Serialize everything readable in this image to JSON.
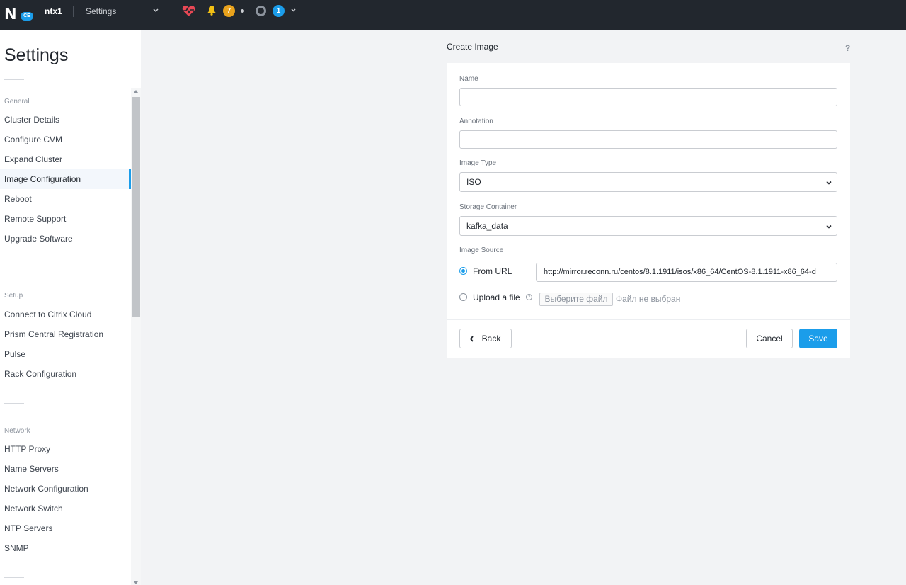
{
  "topbar": {
    "logo_mark": "N",
    "logo_badge": "CE",
    "cluster_name": "ntx1",
    "nav_label": "Settings",
    "alert_count": "7",
    "task_count": "1",
    "icons": [
      "nutanix-logo",
      "chevron-down-icon",
      "heart-health-icon",
      "bell-icon",
      "status-dot-icon",
      "tasks-ring-icon",
      "chevron-down-icon"
    ],
    "colors": {
      "bar": "#22272e",
      "heart": "#e84855",
      "bell": "#f2c014",
      "alert_badge": "#e8a21c",
      "task_badge": "#1b9dea"
    }
  },
  "sidebar": {
    "title": "Settings",
    "sections": [
      {
        "heading": "General",
        "items": [
          "Cluster Details",
          "Configure CVM",
          "Expand Cluster",
          "Image Configuration",
          "Reboot",
          "Remote Support",
          "Upgrade Software"
        ]
      },
      {
        "heading": "Setup",
        "items": [
          "Connect to Citrix Cloud",
          "Prism Central Registration",
          "Pulse",
          "Rack Configuration"
        ]
      },
      {
        "heading": "Network",
        "items": [
          "HTTP Proxy",
          "Name Servers",
          "Network Configuration",
          "Network Switch",
          "NTP Servers",
          "SNMP"
        ]
      }
    ],
    "active_item": "Image Configuration"
  },
  "dialog": {
    "title": "Create Image",
    "help": "?",
    "name_label": "Name",
    "name_value": "",
    "annotation_label": "Annotation",
    "annotation_value": "",
    "image_type_label": "Image Type",
    "image_type_value": "ISO",
    "storage_label": "Storage Container",
    "storage_value": "kafka_data",
    "source_label": "Image Source",
    "from_url_label": "From URL",
    "url_value": "http://mirror.reconn.ru/centos/8.1.1911/isos/x86_64/CentOS-8.1.1911-x86_64-d",
    "upload_label": "Upload a file",
    "file_button": "Выберите файл",
    "file_status": "Файл не выбран",
    "back_label": "Back",
    "cancel_label": "Cancel",
    "save_label": "Save",
    "accent_color": "#1b9dea"
  }
}
